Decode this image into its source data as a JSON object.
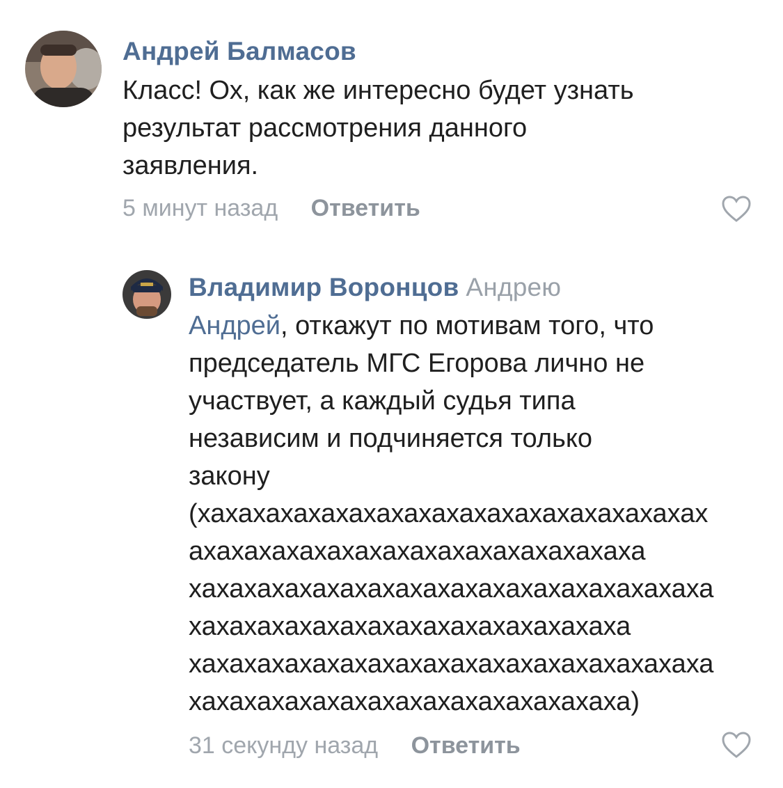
{
  "comments": [
    {
      "author": "Андрей Балмасов",
      "reply_to": "",
      "mention": "",
      "text": "Класс! Ох, как же интересно будет узнать\nрезультат рассмотрения данного\nзаявления.",
      "time": "5 минут назад",
      "reply_label": "Ответить",
      "like_icon": "heart-outline-icon"
    },
    {
      "author": "Владимир Воронцов",
      "reply_to": "Андрею",
      "mention": "Андрей",
      "text": ", откажут по мотивам того, что\nпредседатель МГС Егорова лично не\nучаствует, а каждый судья типа\nнезависим и подчиняется только\nзакону\n(хахахахахахахахахахахахахахахахахахах\nахахахахахахахахахахахахахахахаха\nхахахахахахахахахахахахахахахахахахаха\nхахахахахахахахахахахахахахахаха\nхахахахахахахахахахахахахахахахахахаха\nхахахахахахахахахахахахахахахаха)",
      "time": "31 секунду назад",
      "reply_label": "Ответить",
      "like_icon": "heart-outline-icon"
    }
  ],
  "colors": {
    "link": "#4f6d93",
    "muted": "#a0a6ad",
    "text": "#1f1f1f"
  }
}
